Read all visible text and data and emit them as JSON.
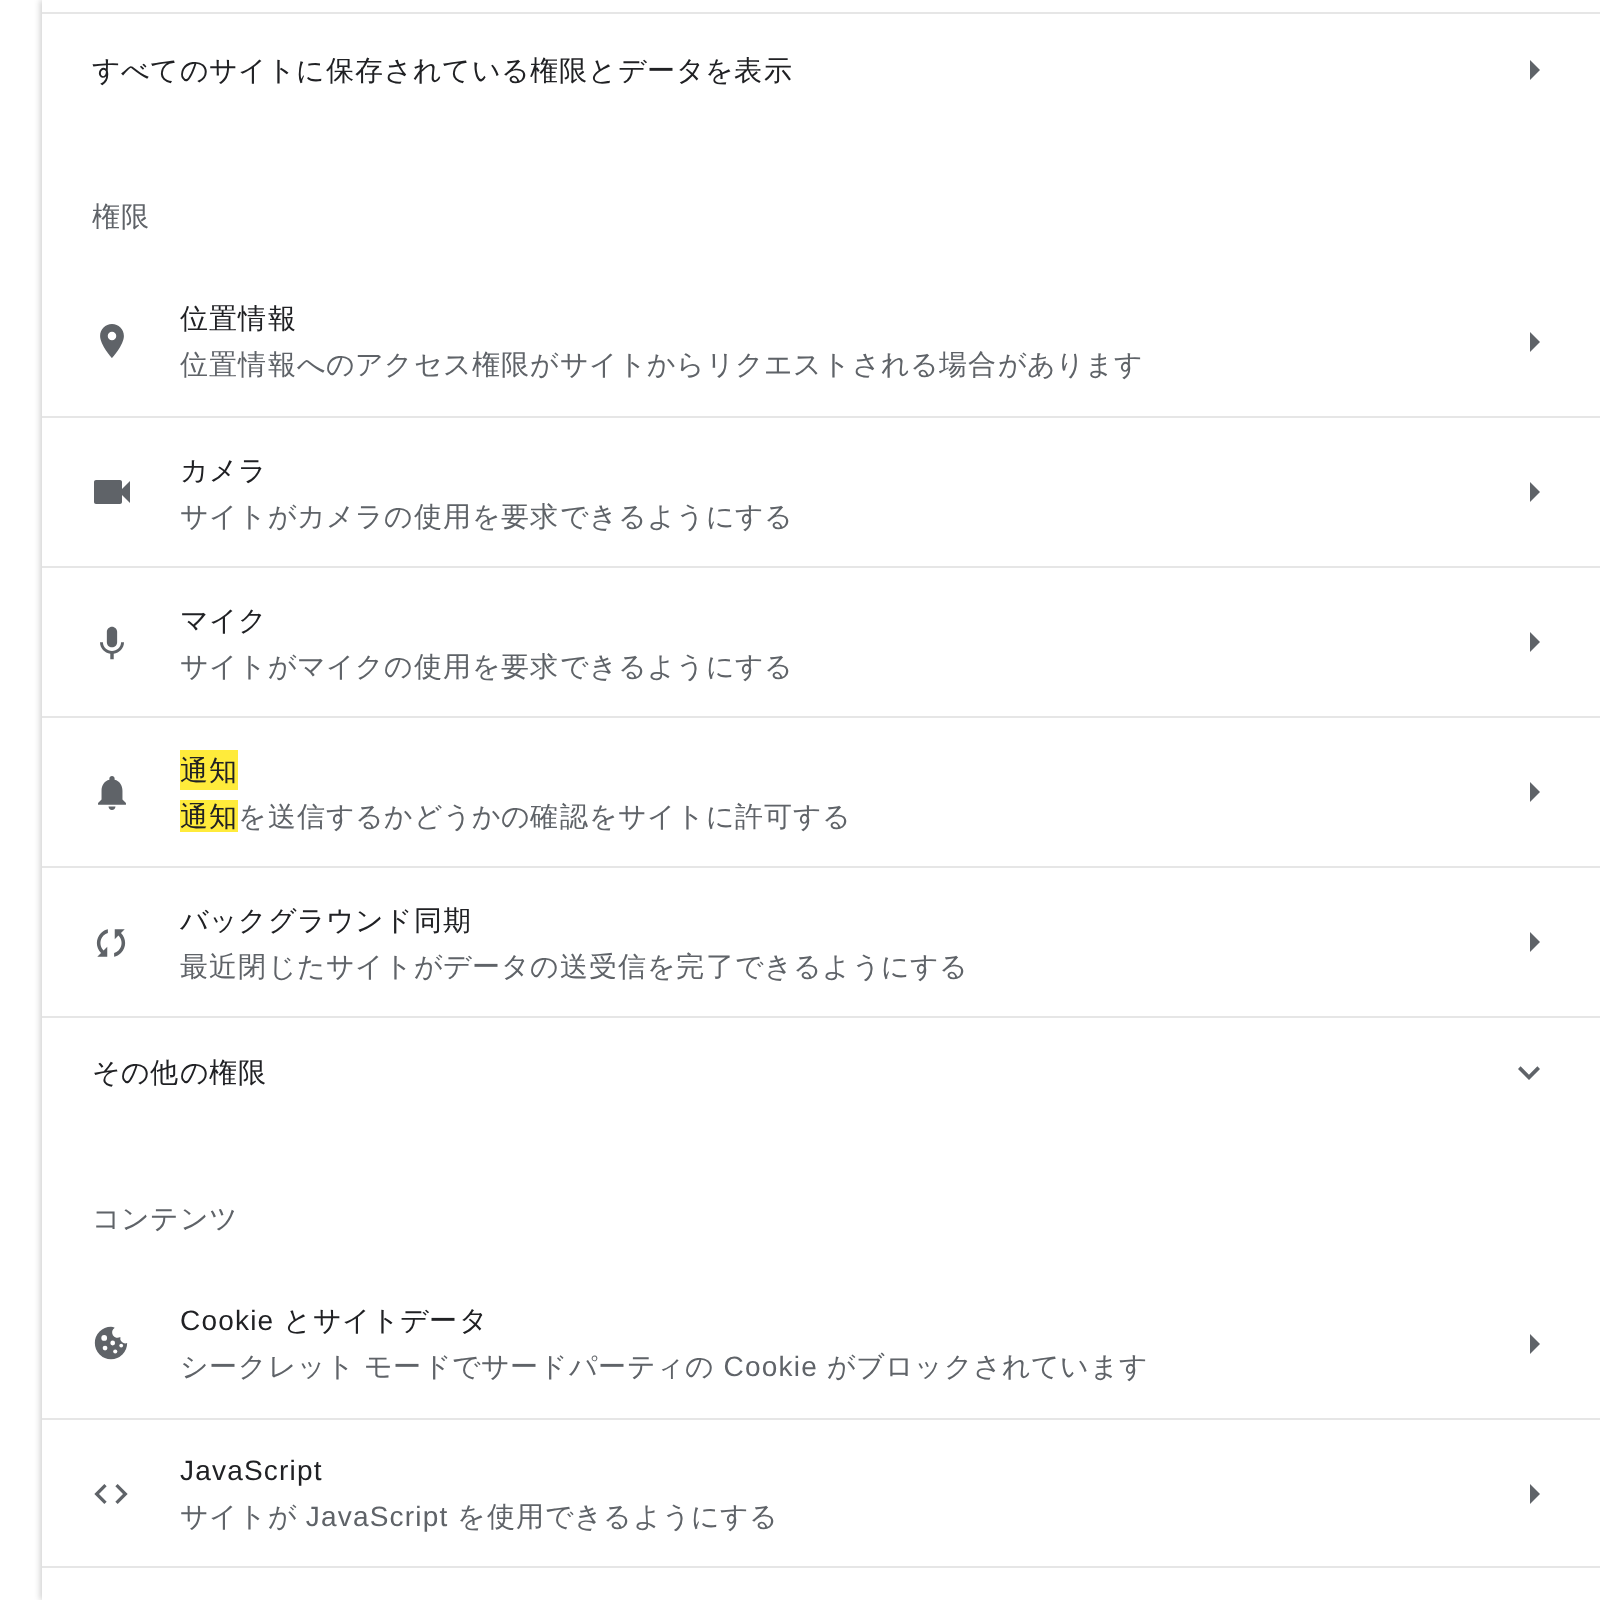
{
  "all_sites_link": {
    "label": "すべてのサイトに保存されている権限とデータを表示"
  },
  "permissions": {
    "heading": "権限",
    "items": [
      {
        "title": "位置情報",
        "title_highlighted": false,
        "subtitle": [
          {
            "text": "位置情報へのアクセス権限がサイトからリクエストされる場合があります",
            "highlighted": false
          }
        ]
      },
      {
        "title": "カメラ",
        "title_highlighted": false,
        "subtitle": [
          {
            "text": "サイトがカメラの使用を要求できるようにする",
            "highlighted": false
          }
        ]
      },
      {
        "title": "マイク",
        "title_highlighted": false,
        "subtitle": [
          {
            "text": "サイトがマイクの使用を要求できるようにする",
            "highlighted": false
          }
        ]
      },
      {
        "title": "通知",
        "title_highlighted": true,
        "subtitle": [
          {
            "text": "通知",
            "highlighted": true
          },
          {
            "text": "を送信するかどうかの確認をサイトに許可する",
            "highlighted": false
          }
        ]
      },
      {
        "title": "バックグラウンド同期",
        "title_highlighted": false,
        "subtitle": [
          {
            "text": "最近閉じたサイトがデータの送受信を完了できるようにする",
            "highlighted": false
          }
        ]
      }
    ],
    "more": {
      "label": "その他の権限",
      "expanded": false
    }
  },
  "content": {
    "heading": "コンテンツ",
    "items": [
      {
        "title": "Cookie とサイトデータ",
        "title_highlighted": false,
        "subtitle": [
          {
            "text": "シークレット モードでサードパーティの Cookie がブロックされています",
            "highlighted": false
          }
        ]
      },
      {
        "title": "JavaScript",
        "title_highlighted": false,
        "subtitle": [
          {
            "text": "サイトが JavaScript を使用できるようにする",
            "highlighted": false
          }
        ]
      }
    ]
  }
}
